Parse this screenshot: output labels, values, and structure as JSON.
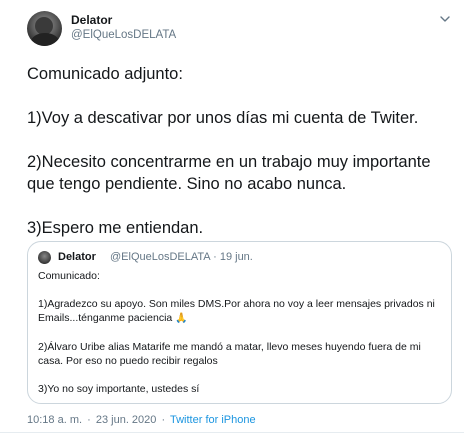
{
  "author": {
    "name": "Delator",
    "handle": "@ElQueLosDELATA"
  },
  "tweet": {
    "paragraphs": [
      "Comunicado adjunto:",
      "1)Voy a descativar por unos días mi cuenta de Twiter.",
      "2)Necesito concentrarme en un trabajo muy importante que tengo pendiente. Sino no acabo nunca.",
      "3)Espero me entiendan."
    ]
  },
  "quoted": {
    "name": "Delator",
    "handle": "@ElQueLosDELATA",
    "dot": "·",
    "date": "19 jun.",
    "intro": "Comunicado:",
    "p1": "1)Agradezco su apoyo. Son miles DMS.Por ahora no voy a leer mensajes privados ni Emails...ténganme paciencia",
    "p1_emoji": "🙏",
    "p2": "2)Álvaro Uribe alias Matarife me mandó a matar, llevo meses huyendo fuera de mi casa. Por eso no puedo recibir regalos",
    "p3": "3)Yo no soy importante, ustedes sí"
  },
  "footer": {
    "time": "10:18 a. m.",
    "dot": "·",
    "date": "23 jun. 2020",
    "dot2": "·",
    "source": "Twitter for iPhone"
  },
  "icons": {
    "caret": "chevron-down-icon",
    "avatar_color": "#2c2c2c",
    "link_color": "#1b95e0",
    "muted_color": "#657786"
  }
}
